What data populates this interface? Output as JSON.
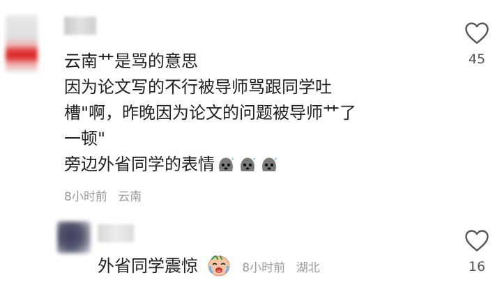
{
  "comments": [
    {
      "lines": [
        "云南艹是骂的意思",
        "因为论文写的不行被导师骂跟同学吐",
        "槽\"啊，昨晚因为论文的问题被导师艹了",
        "一顿\"",
        "旁边外省同学的表情"
      ],
      "time": "8小时前",
      "location": "云南",
      "likes": "45"
    },
    {
      "text": "外省同学震惊",
      "time": "8小时前",
      "location": "湖北",
      "likes": "16"
    }
  ],
  "icons": {
    "like": "heart-outline-icon",
    "emoji1": "sweat-blob-emoji",
    "emoji2": "tearful-shocked-face-emoji"
  },
  "colors": {
    "meta": "#9a9a9a",
    "text": "#1f1f1f"
  }
}
